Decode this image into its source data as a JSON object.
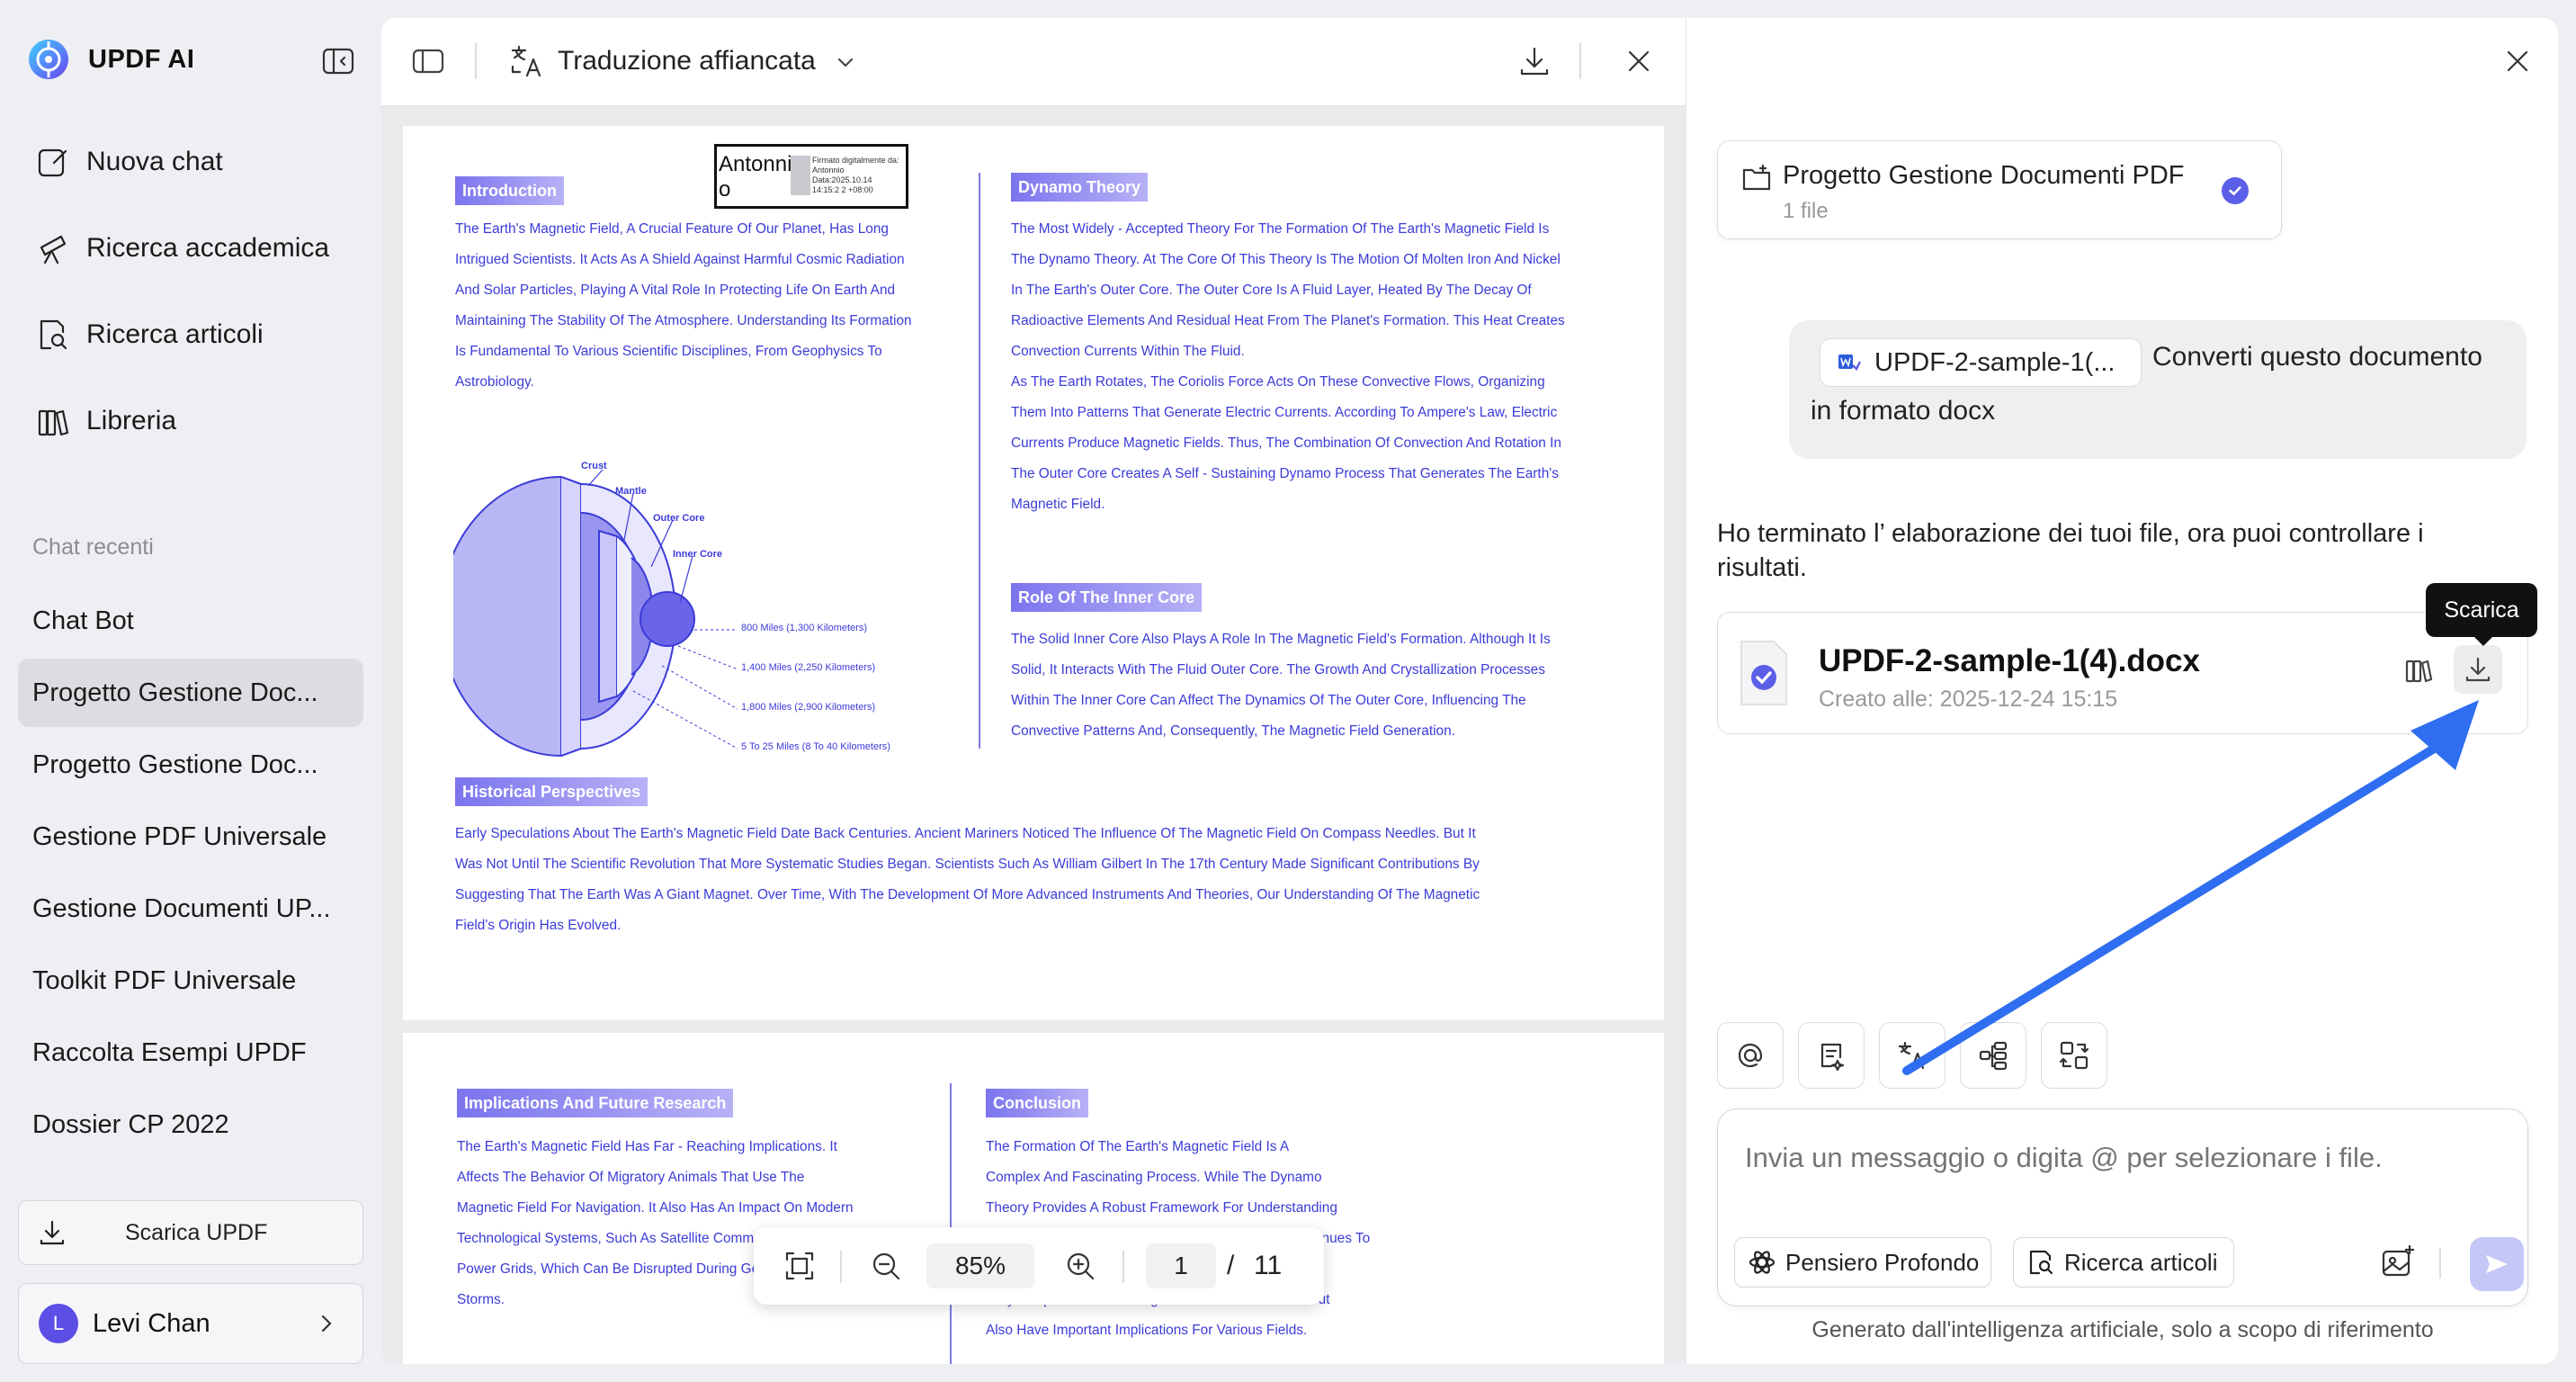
{
  "app": {
    "name": "UPDF AI"
  },
  "sidebar": {
    "nav": [
      {
        "label": "Nuova chat",
        "icon": "edit-icon"
      },
      {
        "label": "Ricerca accademica",
        "icon": "telescope-icon"
      },
      {
        "label": "Ricerca articoli",
        "icon": "search-doc-icon"
      },
      {
        "label": "Libreria",
        "icon": "library-icon"
      }
    ],
    "recent_label": "Chat recenti",
    "recent": [
      "Chat Bot",
      "Progetto Gestione Doc...",
      "Progetto Gestione Doc...",
      "Gestione PDF Universale",
      "Gestione Documenti UP...",
      "Toolkit PDF Universale",
      "Raccolta Esempi UPDF",
      "Dossier CP 2022"
    ],
    "active_index": 1,
    "download_label": "Scarica UPDF",
    "user": {
      "initial": "L",
      "name": "Levi Chan"
    }
  },
  "doc": {
    "mode": "Traduzione affiancata",
    "signature": {
      "name": "Antonni o",
      "stamp": "Firmato digitalmente da: Antonnio Data:2025.10.14 14:15:2 2 +08:00"
    },
    "page1": {
      "intro_title": "Introduction",
      "intro_lines": [
        "The Earth's Magnetic Field, A Crucial Feature Of Our Planet, Has Long",
        "Intrigued Scientists. It Acts As A Shield Against Harmful Cosmic Radiation",
        "And Solar Particles, Playing A Vital Role In Protecting Life On Earth And",
        "Maintaining The Stability Of The Atmosphere. Understanding Its Formation",
        "Is Fundamental To Various Scientific Disciplines, From Geophysics To",
        "Astrobiology."
      ],
      "diagram": {
        "labels": [
          "Crust",
          "Mantle",
          "Outer Core",
          "Inner Core"
        ],
        "depths": [
          "800 Miles (1,300 Kilometers)",
          "1,400 Miles (2,250 Kilometers)",
          "1,800 Miles (2,900 Kilometers)",
          "5 To 25 Miles (8 To 40 Kilometers)"
        ]
      },
      "dynamo_title": "Dynamo Theory",
      "dynamo_lines": [
        "The Most Widely - Accepted Theory For The Formation Of The Earth's Magnetic Field Is",
        "The Dynamo Theory. At The Core Of This Theory Is The Motion Of Molten Iron And Nickel",
        "In The Earth's Outer Core. The Outer Core Is A Fluid Layer, Heated By The Decay Of",
        "Radioactive Elements And Residual Heat From The Planet's Formation. This Heat Creates",
        "Convection Currents Within The Fluid.",
        "As The Earth Rotates, The Coriolis Force Acts On These Convective Flows, Organizing",
        "Them Into Patterns That Generate Electric Currents. According To Ampere's Law, Electric",
        "Currents Produce Magnetic Fields. Thus, The Combination Of Convection And Rotation In",
        "The Outer Core Creates A Self - Sustaining Dynamo Process That Generates The Earth's",
        "Magnetic Field."
      ],
      "inner_title": "Role Of The Inner Core",
      "inner_lines": [
        "The Solid Inner Core Also Plays A Role In The Magnetic Field's Formation. Although It Is",
        "Solid, It Interacts With The Fluid Outer Core. The Growth And Crystallization Processes",
        "Within The Inner Core Can Affect The Dynamics Of The Outer Core, Influencing The",
        "Convective Patterns And, Consequently, The Magnetic Field Generation."
      ],
      "hist_title": "Historical Perspectives",
      "hist_lines": [
        "Early Speculations About The Earth's Magnetic Field Date Back Centuries. Ancient Mariners Noticed The Influence Of The Magnetic Field On Compass Needles. But It",
        "Was Not Until The Scientific Revolution That More Systematic Studies Began. Scientists Such As William Gilbert In The 17th Century Made Significant Contributions By",
        "Suggesting That The Earth Was A Giant Magnet. Over Time, With The Development Of More Advanced Instruments And Theories, Our Understanding Of The Magnetic",
        "Field's Origin Has Evolved."
      ]
    },
    "page2": {
      "impl_title": "Implications And Future Research",
      "impl_lines": [
        "The Earth's Magnetic Field Has Far - Reaching Implications. It",
        "Affects The Behavior Of Migratory Animals That Use The",
        "Magnetic Field For Navigation. It Also Has An Impact On Modern",
        "Technological Systems, Such As Satellite Communications And",
        "Power Grids, Which Can Be Disrupted During Geomagnetic",
        "Storms."
      ],
      "concl_title": "Conclusion",
      "concl_lines": [
        "The Formation Of The Earth's Magnetic Field Is A",
        "Complex And Fascinating Process. While The Dynamo",
        "Theory Provides A Robust Framework For Understanding",
        "How The Magnetic Field Is Generated, Research Continues To",
        "Uncover New Details. Studying The Magnetic Field Not",
        "Only Deepen Our Knowledge Of The Earth's Interior But",
        "Also Have Important Implications For Various Fields."
      ]
    },
    "zoom": "85%",
    "page_current": "1",
    "page_sep": "/",
    "page_total": "11"
  },
  "chat": {
    "project": {
      "title": "Progetto Gestione Documenti PDF",
      "count": "1 file"
    },
    "user_message": {
      "file": "UPDF-2-sample-1(...",
      "line1": "Converti questo documento",
      "line2": "in formato docx"
    },
    "ai_message": "Ho terminato l’ elaborazione dei tuoi file, ora puoi controllare i risultati.",
    "result": {
      "name": "UPDF-2-sample-1(4).docx",
      "created": "Creato alle: 2025-12-24 15:15"
    },
    "tooltip": "Scarica",
    "input_placeholder": "Invia un messaggio o digita @ per selezionare i file.",
    "pill_deep": "Pensiero Profondo",
    "pill_search": "Ricerca articoli",
    "footer": "Generato dall'intelligenza artificiale, solo a scopo di riferimento"
  },
  "colors": {
    "accent": "#5b5fe8",
    "arrow": "#2f6ef0",
    "doc_text": "#3b3bd8"
  }
}
